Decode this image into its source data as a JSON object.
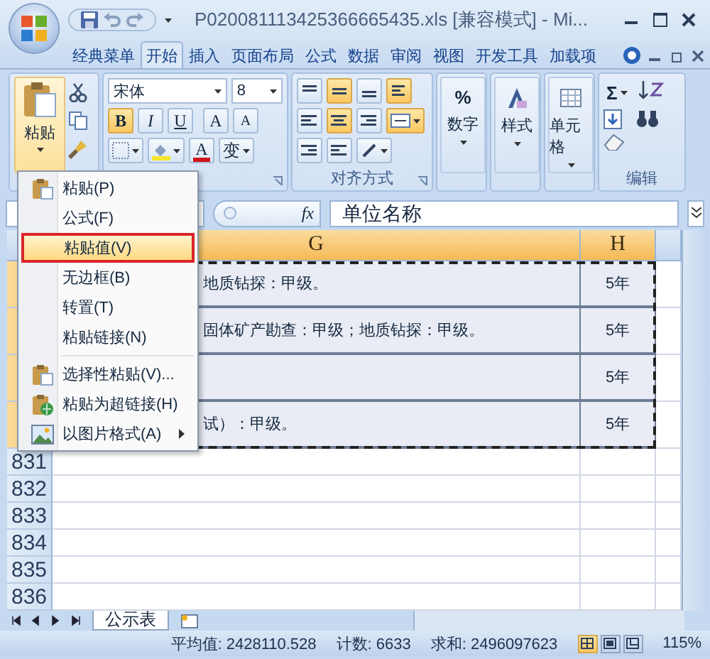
{
  "window": {
    "title": "P020081113425366665435.xls  [兼容模式] - Mi..."
  },
  "ribbon_tabs": [
    {
      "label": "经典菜单",
      "selected": false
    },
    {
      "label": "开始",
      "selected": true
    },
    {
      "label": "插入",
      "selected": false
    },
    {
      "label": "页面布局",
      "selected": false
    },
    {
      "label": "公式",
      "selected": false
    },
    {
      "label": "数据",
      "selected": false
    },
    {
      "label": "审阅",
      "selected": false
    },
    {
      "label": "视图",
      "selected": false
    },
    {
      "label": "开发工具",
      "selected": false
    },
    {
      "label": "加载项",
      "selected": false
    }
  ],
  "clipboard": {
    "paste_label": "粘贴"
  },
  "font": {
    "name": "宋体",
    "size": "8",
    "grow": "A",
    "shrink": "A",
    "color_letter": "A",
    "phonetic": "变",
    "buttons": [
      {
        "label": "B",
        "on": true
      },
      {
        "label": "I",
        "on": false
      },
      {
        "label": "U",
        "on": false
      }
    ]
  },
  "alignment": {
    "label": "对齐方式",
    "buttons": [
      {
        "on": false
      },
      {
        "on": true
      },
      {
        "on": false
      },
      {
        "on": true
      },
      {
        "on": false
      },
      {
        "on": true
      },
      {
        "on": false
      },
      {
        "on": true
      }
    ]
  },
  "collapsed_groups": [
    {
      "symbol": "%",
      "label": "数字"
    },
    {
      "label": "样式"
    },
    {
      "label": "单元格"
    }
  ],
  "editing": {
    "sum_symbol": "Σ",
    "label": "编辑"
  },
  "formula_bar": {
    "function_symbol": "fx",
    "value": "单位名称"
  },
  "sheet": {
    "columns": [
      {
        "label": "G",
        "selected": true
      },
      {
        "label": "H",
        "selected": true
      }
    ],
    "rows": [
      {
        "g": "地质钻探：甲级。",
        "h": "5年"
      },
      {
        "g": "固体矿产勘查：甲级；地质钻探：甲级。",
        "h": "5年"
      },
      {
        "h": "5年"
      },
      {
        "g": "试）：甲级。",
        "h": "5年"
      }
    ],
    "more_rows": [
      "831",
      "832",
      "833",
      "834",
      "835",
      "836"
    ]
  },
  "context_menu": {
    "items": [
      {
        "label": "粘贴(P)",
        "selected": false,
        "has_icon": true
      },
      {
        "label": "公式(F)",
        "selected": false
      },
      {
        "label": "粘贴值(V)",
        "selected": true
      },
      {
        "label": "无边框(B)",
        "selected": false
      },
      {
        "label": "转置(T)",
        "selected": false
      },
      {
        "label": "粘贴链接(N)",
        "selected": false
      },
      {
        "label": "选择性粘贴(V)...",
        "selected": false,
        "has_icon": true,
        "separator_before": true
      },
      {
        "label": "粘贴为超链接(H)",
        "selected": false,
        "has_icon": true
      },
      {
        "label": "以图片格式(A)",
        "selected": false,
        "has_icon": true,
        "submenu": true
      }
    ]
  },
  "sheet_tabs": [
    {
      "label": "公示表",
      "selected": true
    }
  ],
  "status_bar": {
    "average": "平均值: 2428110.528",
    "count": "计数: 6633",
    "sum": "求和: 2496097623",
    "views": [
      {
        "selected": true
      },
      {
        "selected": false
      },
      {
        "selected": false
      }
    ],
    "zoom": "115%"
  }
}
